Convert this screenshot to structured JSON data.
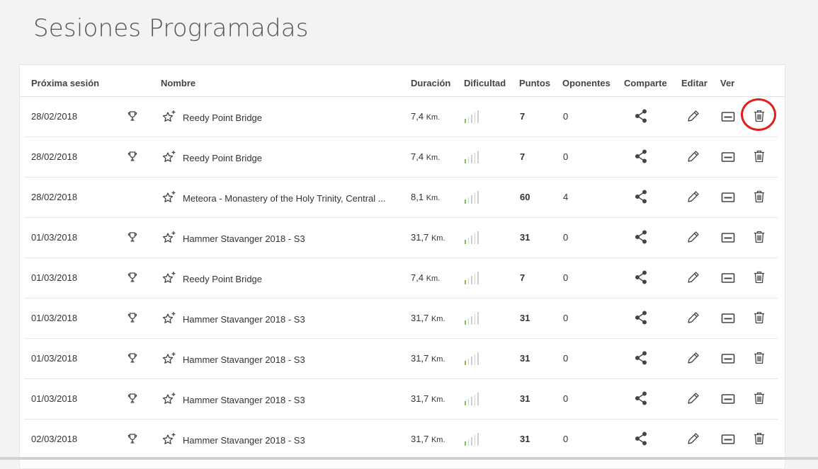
{
  "page": {
    "title": "Sesiones Programadas"
  },
  "columns": {
    "next_session": "Próxima sesión",
    "name": "Nombre",
    "duration": "Duración",
    "difficulty": "Dificultad",
    "points": "Puntos",
    "opponents": "Oponentes",
    "share": "Comparte",
    "edit": "Editar",
    "view": "Ver"
  },
  "colors": {
    "difficulty_on": "#7cc04a",
    "difficulty_off": "#cfcfcf",
    "highlight": "#e01e1e"
  },
  "rows": [
    {
      "date": "28/02/2018",
      "trophy": true,
      "name": "Reedy Point Bridge",
      "distance": "7,4",
      "unit": "Km.",
      "difficulty_level": 1,
      "points": "7",
      "opponents": "0"
    },
    {
      "date": "28/02/2018",
      "trophy": true,
      "name": "Reedy Point Bridge",
      "distance": "7,4",
      "unit": "Km.",
      "difficulty_level": 1,
      "points": "7",
      "opponents": "0"
    },
    {
      "date": "28/02/2018",
      "trophy": false,
      "name": "Meteora - Monastery of the Holy Trinity, Central ...",
      "distance": "8,1",
      "unit": "Km.",
      "difficulty_level": 1,
      "points": "60",
      "opponents": "4"
    },
    {
      "date": "01/03/2018",
      "trophy": true,
      "name": "Hammer Stavanger 2018 - S3",
      "distance": "31,7",
      "unit": "Km.",
      "difficulty_level": 1,
      "points": "31",
      "opponents": "0"
    },
    {
      "date": "01/03/2018",
      "trophy": true,
      "name": "Reedy Point Bridge",
      "distance": "7,4",
      "unit": "Km.",
      "difficulty_level": 1,
      "points": "7",
      "opponents": "0"
    },
    {
      "date": "01/03/2018",
      "trophy": true,
      "name": "Hammer Stavanger 2018 - S3",
      "distance": "31,7",
      "unit": "Km.",
      "difficulty_level": 1,
      "points": "31",
      "opponents": "0"
    },
    {
      "date": "01/03/2018",
      "trophy": true,
      "name": "Hammer Stavanger 2018 - S3",
      "distance": "31,7",
      "unit": "Km.",
      "difficulty_level": 1,
      "points": "31",
      "opponents": "0"
    },
    {
      "date": "01/03/2018",
      "trophy": true,
      "name": "Hammer Stavanger 2018 - S3",
      "distance": "31,7",
      "unit": "Km.",
      "difficulty_level": 1,
      "points": "31",
      "opponents": "0"
    },
    {
      "date": "02/03/2018",
      "trophy": true,
      "name": "Hammer Stavanger 2018 - S3",
      "distance": "31,7",
      "unit": "Km.",
      "difficulty_level": 1,
      "points": "31",
      "opponents": "0"
    }
  ],
  "icons": [
    "trophy-icon",
    "star-plus-icon",
    "share-icon",
    "pencil-icon",
    "view-icon",
    "trash-icon"
  ]
}
